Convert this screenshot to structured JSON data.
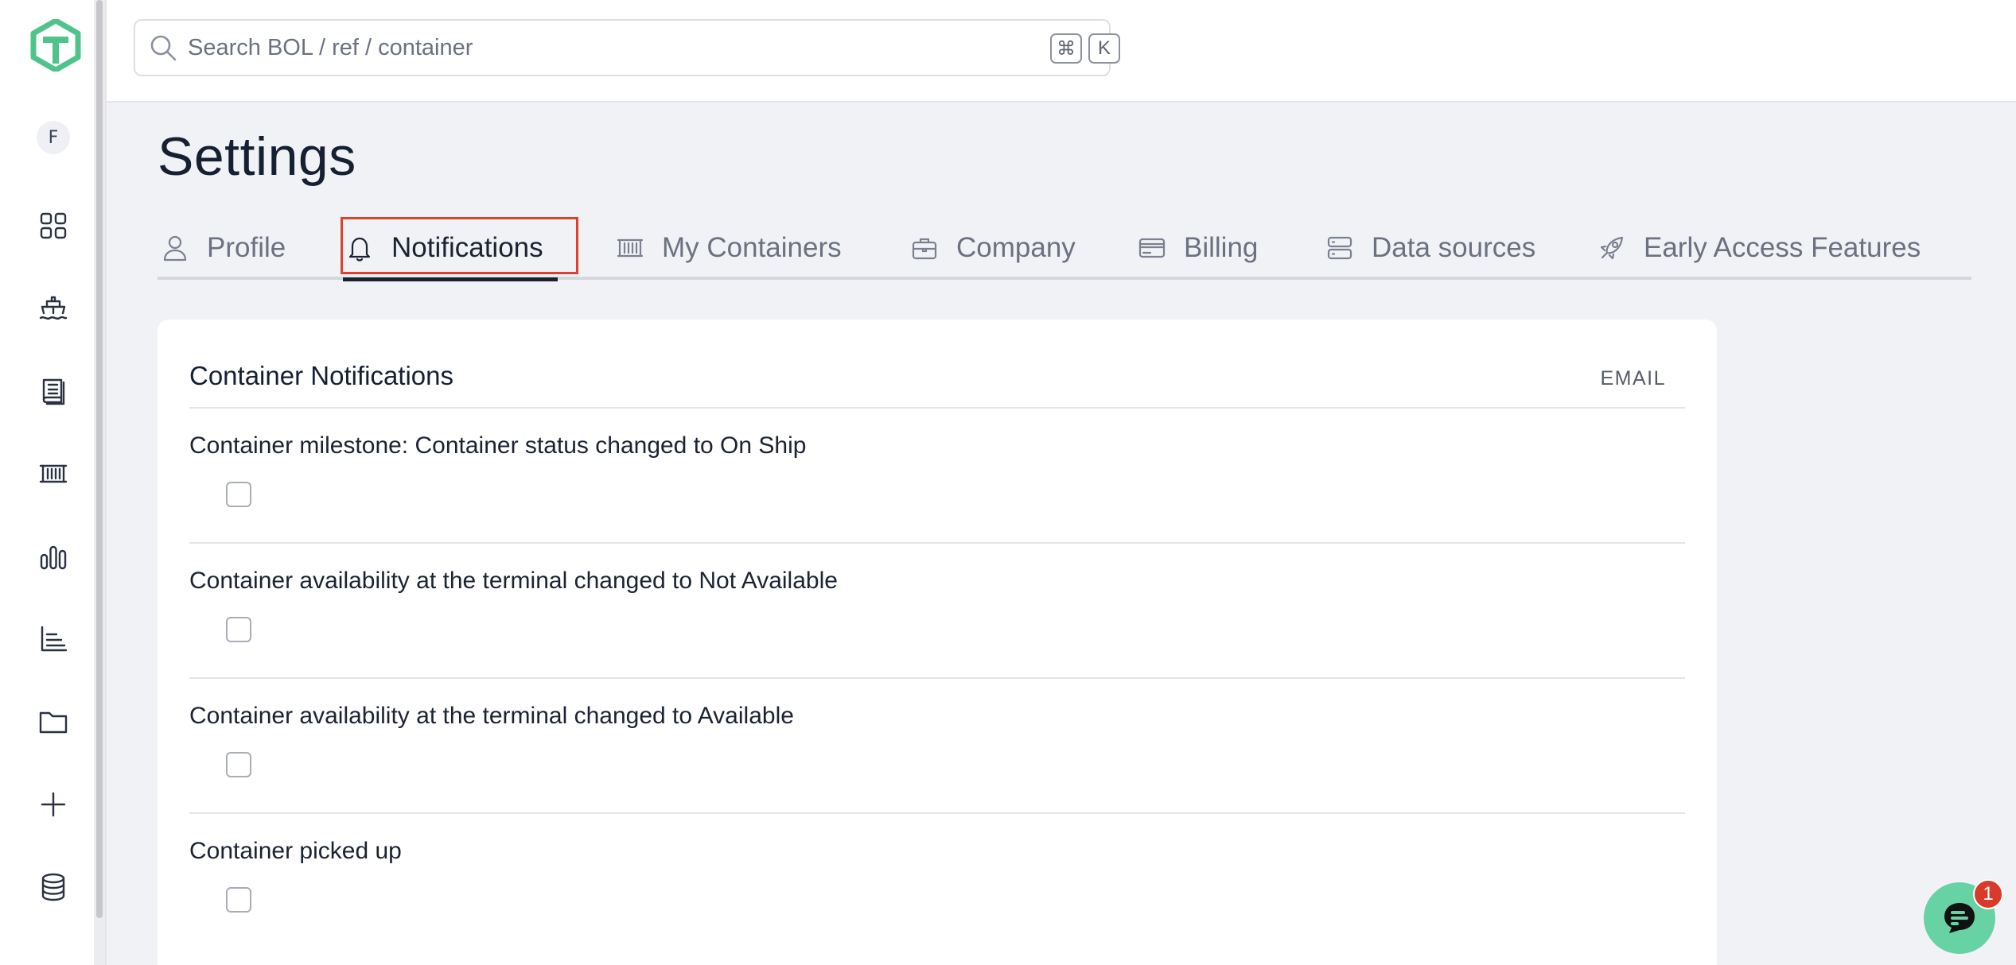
{
  "sidebar": {
    "avatar_initial": "F",
    "items": [
      {
        "name": "dashboard-icon"
      },
      {
        "name": "ship-icon"
      },
      {
        "name": "book-icon"
      },
      {
        "name": "container-icon"
      },
      {
        "name": "bar-chart-icon"
      },
      {
        "name": "line-chart-icon"
      },
      {
        "name": "folder-icon"
      },
      {
        "name": "plus-icon"
      },
      {
        "name": "database-icon"
      }
    ],
    "brand_color": "#4fc38a"
  },
  "search": {
    "placeholder": "Search BOL / ref / container",
    "shortcut_modifier": "⌘",
    "shortcut_key": "K"
  },
  "page": {
    "title": "Settings"
  },
  "tabs": [
    {
      "label": "Profile",
      "icon": "user-icon",
      "active": false
    },
    {
      "label": "Notifications",
      "icon": "bell-icon",
      "active": true
    },
    {
      "label": "My Containers",
      "icon": "container-icon",
      "active": false
    },
    {
      "label": "Company",
      "icon": "briefcase-icon",
      "active": false
    },
    {
      "label": "Billing",
      "icon": "credit-card-icon",
      "active": false
    },
    {
      "label": "Data sources",
      "icon": "server-icon",
      "active": false
    },
    {
      "label": "Early Access Features",
      "icon": "rocket-icon",
      "active": false
    }
  ],
  "notifications": {
    "section_title": "Container Notifications",
    "column_header": "EMAIL",
    "rows": [
      {
        "label": "Container milestone: Container status changed to On Ship",
        "email": false
      },
      {
        "label": "Container availability at the terminal changed to Not Available",
        "email": false
      },
      {
        "label": "Container availability at the terminal changed to Available",
        "email": false
      },
      {
        "label": "Container picked up",
        "email": false
      }
    ]
  },
  "chat": {
    "badge_count": "1",
    "color": "#67d2a3"
  },
  "accent": {
    "highlight": "#e0412f"
  }
}
